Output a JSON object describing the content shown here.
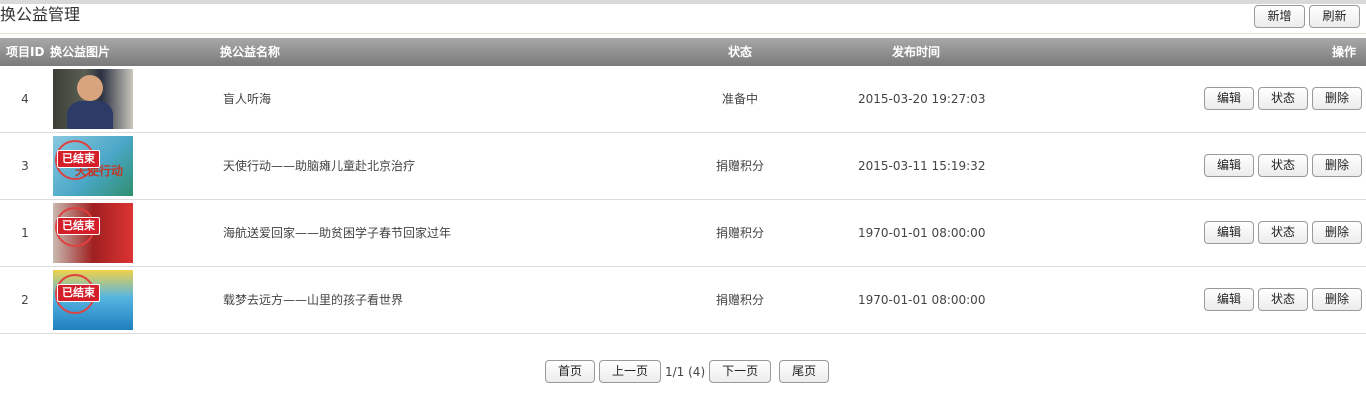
{
  "header": {
    "title": "换公益管理",
    "add_label": "新增",
    "refresh_label": "刷新"
  },
  "table": {
    "columns": {
      "id": "项目ID",
      "image": "换公益图片",
      "name": "换公益名称",
      "status": "状态",
      "time": "发布时间",
      "ops": "操作"
    },
    "rows": [
      {
        "id": "4",
        "name": "盲人听海",
        "status": "准备中",
        "time": "2015-03-20 19:27:03"
      },
      {
        "id": "3",
        "name": "天使行动——助脑瘫儿童赴北京治疗",
        "status": "捐赠积分",
        "time": "2015-03-11 15:19:32",
        "stamp": "已结束",
        "banner": "天使行动"
      },
      {
        "id": "1",
        "name": "海航送爱回家——助贫困学子春节回家过年",
        "status": "捐赠积分",
        "time": "1970-01-01 08:00:00",
        "stamp": "已结束"
      },
      {
        "id": "2",
        "name": "载梦去远方——山里的孩子看世界",
        "status": "捐赠积分",
        "time": "1970-01-01 08:00:00",
        "stamp": "已结束"
      }
    ],
    "actions": {
      "edit": "编辑",
      "status": "状态",
      "delete": "删除"
    }
  },
  "pager": {
    "first": "首页",
    "prev": "上一页",
    "info": "1/1 (4)",
    "next": "下一页",
    "last": "尾页"
  }
}
